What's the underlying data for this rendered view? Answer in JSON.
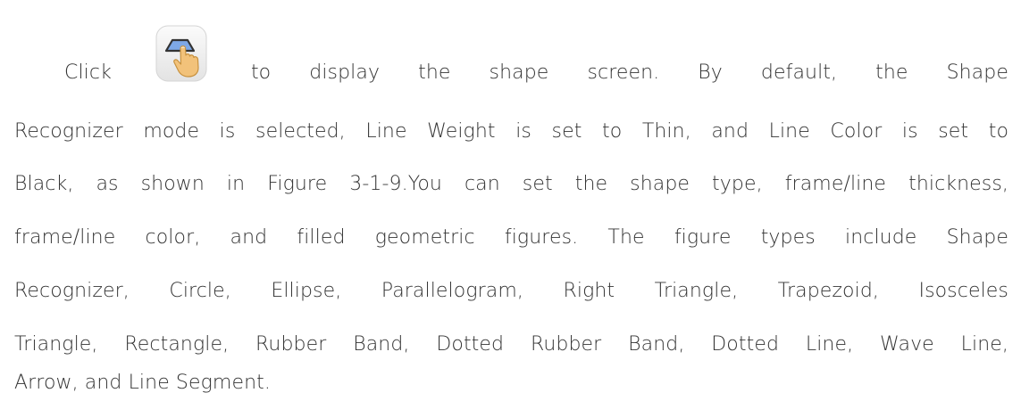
{
  "paragraph": {
    "line1_words": [
      "Click",
      "to",
      "display",
      "the",
      "shape",
      "screen.",
      "By",
      "default,",
      "the",
      "Shape"
    ],
    "line2": "Recognizer mode is selected, Line Weight is set to Thin, and Line Color is set to",
    "line3": "Black, as shown in Figure 3-1-9.You can set the shape type, frame/line thickness,",
    "line4": "frame/line color, and filled geometric figures. The figure types include Shape",
    "line5": "Recognizer, Circle, Ellipse, Parallelogram, Right Triangle, Trapezoid, Isosceles",
    "line6": "Triangle, Rectangle, Rubber Band, Dotted Rubber Band, Dotted Line, Wave Line,",
    "line7": "Arrow, and Line Segment."
  },
  "icon": {
    "name": "shape-tool-icon",
    "tile_color": "#eeeeee",
    "shape_color": "#7ea8e6",
    "hand_color": "#f2c27a"
  }
}
